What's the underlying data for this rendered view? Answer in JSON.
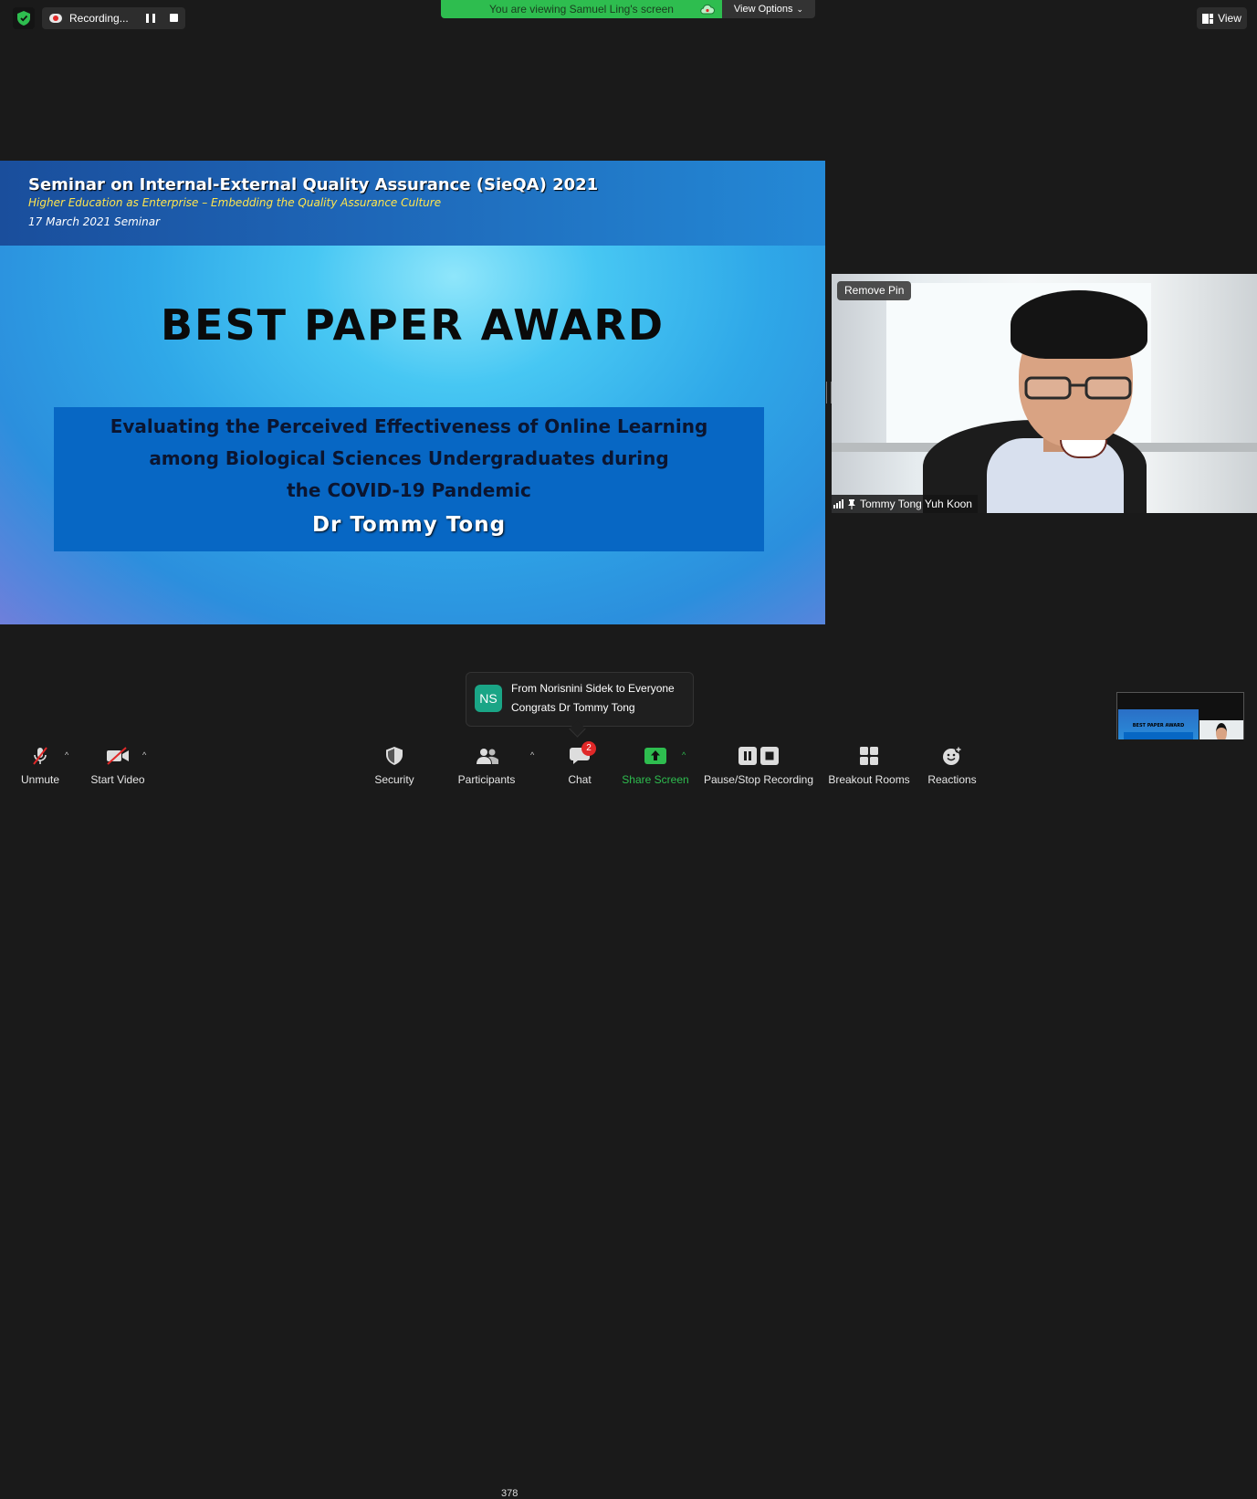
{
  "top_left": {
    "recording_label": "Recording..."
  },
  "banner": {
    "viewing_text": "You are viewing Samuel Ling's screen",
    "view_options_label": "View Options"
  },
  "view_button_label": "View",
  "slide": {
    "title": "Seminar on Internal-External Quality Assurance (SieQA) 2021",
    "subtitle": "Higher Education as Enterprise – Embedding the Quality Assurance Culture",
    "date_line": "17 March 2021   Seminar",
    "award_heading": "BEST PAPER AWARD",
    "paper_title_lines": [
      "Evaluating the Perceived Effectiveness of Online Learning",
      "among Biological Sciences Undergraduates during",
      "the COVID-19 Pandemic"
    ],
    "author": "Dr Tommy Tong"
  },
  "video": {
    "remove_pin_label": "Remove Pin",
    "participant_name": "Tommy Tong Yuh Koon"
  },
  "chat_toast": {
    "initials": "NS",
    "from": "From Norisnini Sidek to Everyone",
    "message": "Congrats Dr Tommy Tong"
  },
  "thumbnail": {
    "award_text": "BEST PAPER AWARD"
  },
  "toolbar": {
    "unmute": "Unmute",
    "start_video": "Start Video",
    "security": "Security",
    "participants": "Participants",
    "participants_count": "378",
    "chat": "Chat",
    "chat_badge": "2",
    "share_screen": "Share Screen",
    "pause_stop_recording": "Pause/Stop Recording",
    "breakout_rooms": "Breakout Rooms",
    "reactions": "Reactions"
  },
  "colors": {
    "share_green": "#2ebd4f",
    "banner_green": "#2ebd4f",
    "badge_red": "#e02828",
    "slide_blue": "#0767c4",
    "initials_teal": "#1aa586"
  }
}
